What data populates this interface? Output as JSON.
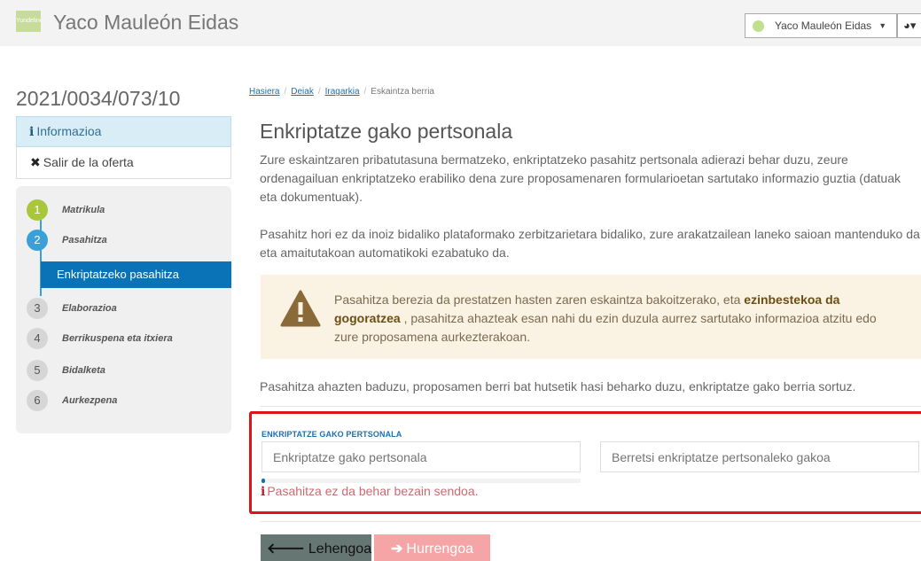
{
  "header": {
    "logo_text": "Yundeline",
    "title": "Yaco Mauleón Eidas",
    "user_menu_label": "Yaco Mauleón Eidas",
    "lang_icon": "globe-icon"
  },
  "sidebar": {
    "record_id": "2021/0034/073/10",
    "info_label": "Informazioa",
    "exit_label": "Salir de la oferta",
    "steps": [
      {
        "number": "1",
        "label": "Matrikula",
        "state": "done"
      },
      {
        "number": "2",
        "label": "Pasahitza",
        "state": "active"
      },
      {
        "number": "3",
        "label": "Elaborazioa",
        "state": "pending"
      },
      {
        "number": "4",
        "label": "Berrikuspena eta itxiera",
        "state": "pending"
      },
      {
        "number": "5",
        "label": "Bidalketa",
        "state": "pending"
      },
      {
        "number": "6",
        "label": "Aurkezpena",
        "state": "pending"
      }
    ],
    "substep_label": "Enkriptatzeko pasahitza"
  },
  "breadcrumb": {
    "items": [
      "Hasiera",
      "Deiak",
      "Iragarkia"
    ],
    "current": "Eskaintza berria"
  },
  "main": {
    "title": "Enkriptatze gako pertsonala",
    "paragraph1": "Zure eskaintzaren pribatutasuna bermatzeko, enkriptatzeko pasahitz pertsonala adierazi behar duzu, zeure ordenagailuan enkriptatzeko erabiliko dena zure proposamenaren formularioetan sartutako informazio guztia (datuak eta dokumentuak).",
    "paragraph2": "Pasahitz hori ez da inoiz bidaliko plataformako zerbitzarietara bidaliko, zure arakatzailean laneko saioan mantenduko da eta amaitutakoan automatikoki ezabatuko da.",
    "warning_pre": "Pasahitza berezia da prestatzen hasten zaren eskaintza bakoitzerako, eta ",
    "warning_bold": "ezinbestekoa da gogoratzea",
    "warning_post": " , pasahitza ahazteak esan nahi du ezin duzula aurrez sartutako informazioa atzitu edo zure proposamena aurkezterakoan.",
    "paragraph3": "Pasahitza ahazten baduzu, proposamen berri bat hutsetik hasi beharko duzu, enkriptatze gako berria sortuz."
  },
  "form": {
    "label": "ENKRIPTATZE GAKO PERTSONALA",
    "password_placeholder": "Enkriptatze gako pertsonala",
    "confirm_placeholder": "Berretsi enkriptatze pertsonaleko gakoa",
    "strength_fraction": 0.01,
    "error_text": "Pasahitza ez da behar bezain sendoa."
  },
  "buttons": {
    "prev_label": "Lehengoa",
    "next_label": "Hurrengoa"
  },
  "colors": {
    "primary": "#0a73b7",
    "done_step": "#a8c73a",
    "error_border": "#e0131b",
    "warning_bg": "#faf2e2"
  }
}
